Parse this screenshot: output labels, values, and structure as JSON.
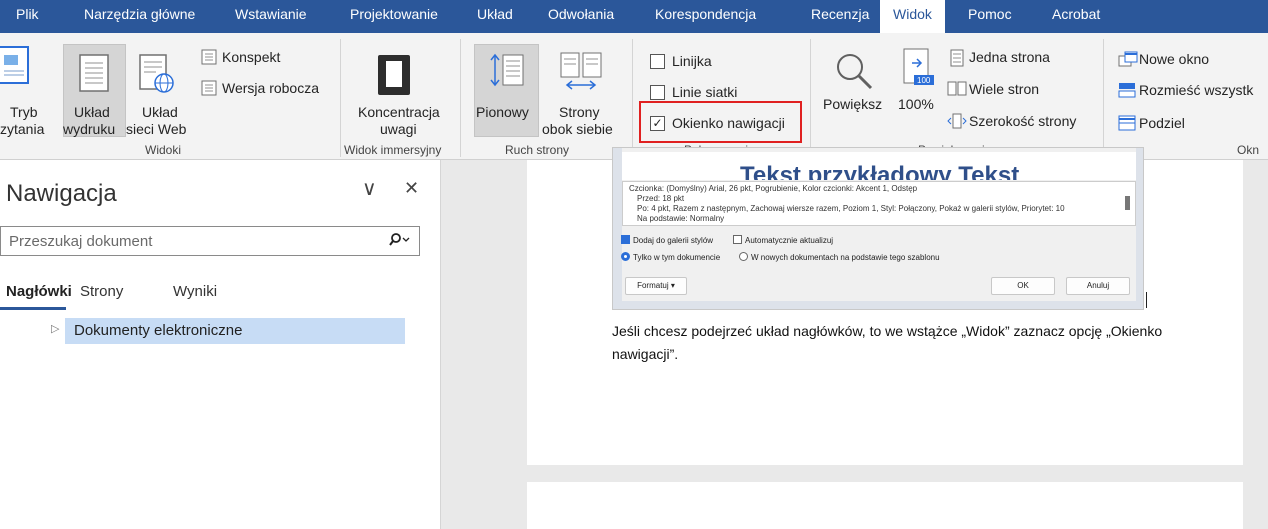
{
  "tabs": {
    "plik": "Plik",
    "narzedzia": "Narzędzia główne",
    "wstawianie": "Wstawianie",
    "projektowanie": "Projektowanie",
    "uklad": "Układ",
    "odwolania": "Odwołania",
    "korespondencja": "Korespondencja",
    "recenzja": "Recenzja",
    "widok": "Widok",
    "pomoc": "Pomoc",
    "acrobat": "Acrobat"
  },
  "ribbon": {
    "widoki": {
      "tryb_line1": "Tryb",
      "tryb_line2": "zytania",
      "uklad_wydruku_line1": "Układ",
      "uklad_wydruku_line2": "wydruku",
      "uklad_sieci_line1": "Układ",
      "uklad_sieci_line2": "sieci Web",
      "konspekt": "Konspekt",
      "wersja_robocza": "Wersja robocza",
      "label": "Widoki"
    },
    "immersyjny": {
      "koncentracja_line1": "Koncentracja",
      "koncentracja_line2": "uwagi",
      "label": "Widok immersyjny"
    },
    "ruch": {
      "pionowy": "Pionowy",
      "strony_line1": "Strony",
      "strony_line2": "obok siebie",
      "label": "Ruch strony"
    },
    "pokazywanie": {
      "linijka": "Linijka",
      "linie_siatki": "Linie siatki",
      "okienko": "Okienko nawigacji",
      "label": "Pokazywanie"
    },
    "powiekszenie": {
      "powieksz": "Powiększ",
      "sto": "100%",
      "jedna_strona": "Jedna strona",
      "wiele_stron": "Wiele stron",
      "szerokosc": "Szerokość strony",
      "label": "Powiększenie"
    },
    "okno": {
      "nowe_okno": "Nowe okno",
      "rozmiesc": "Rozmieść wszystk",
      "podziel": "Podziel",
      "label": "Okn"
    }
  },
  "nav": {
    "title": "Nawigacja",
    "collapse": "∨",
    "close": "✕",
    "search_placeholder": "Przeszukaj dokument",
    "tabs": {
      "naglowki": "Nagłówki",
      "strony": "Strony",
      "wyniki": "Wyniki"
    },
    "heading_item": "Dokumenty elektroniczne"
  },
  "document": {
    "dialog_title": "Tekst przykładowy Tekst",
    "desc_lines": [
      "Czcionka: (Domyślny) Arial, 26 pkt, Pogrubienie, Kolor czcionki: Akcent 1, Odstęp",
      "Przed: 18 pkt",
      "Po: 4 pkt, Razem z następnym, Zachowaj wiersze razem, Poziom 1, Styl: Połączony, Pokaż w galerii stylów, Priorytet: 10",
      "Na podstawie: Normalny"
    ],
    "opt_dodaj": "Dodaj do galerii stylów",
    "opt_auto": "Automatycznie aktualizuj",
    "opt_tylko": "Tylko w tym dokumencie",
    "opt_nowych": "W nowych dokumentach na podstawie tego szablonu",
    "btn_formatuj": "Formatuj ▾",
    "btn_ok": "OK",
    "btn_anuluj": "Anuluj",
    "body_text": "Jeśli chcesz podejrzeć układ nagłówków, to we wstążce „Widok” zaznacz opcję „Okienko nawigacji”."
  },
  "colors": {
    "accent": "#2b579a",
    "highlight": "#c7dcf5",
    "red_box": "#e02020"
  }
}
